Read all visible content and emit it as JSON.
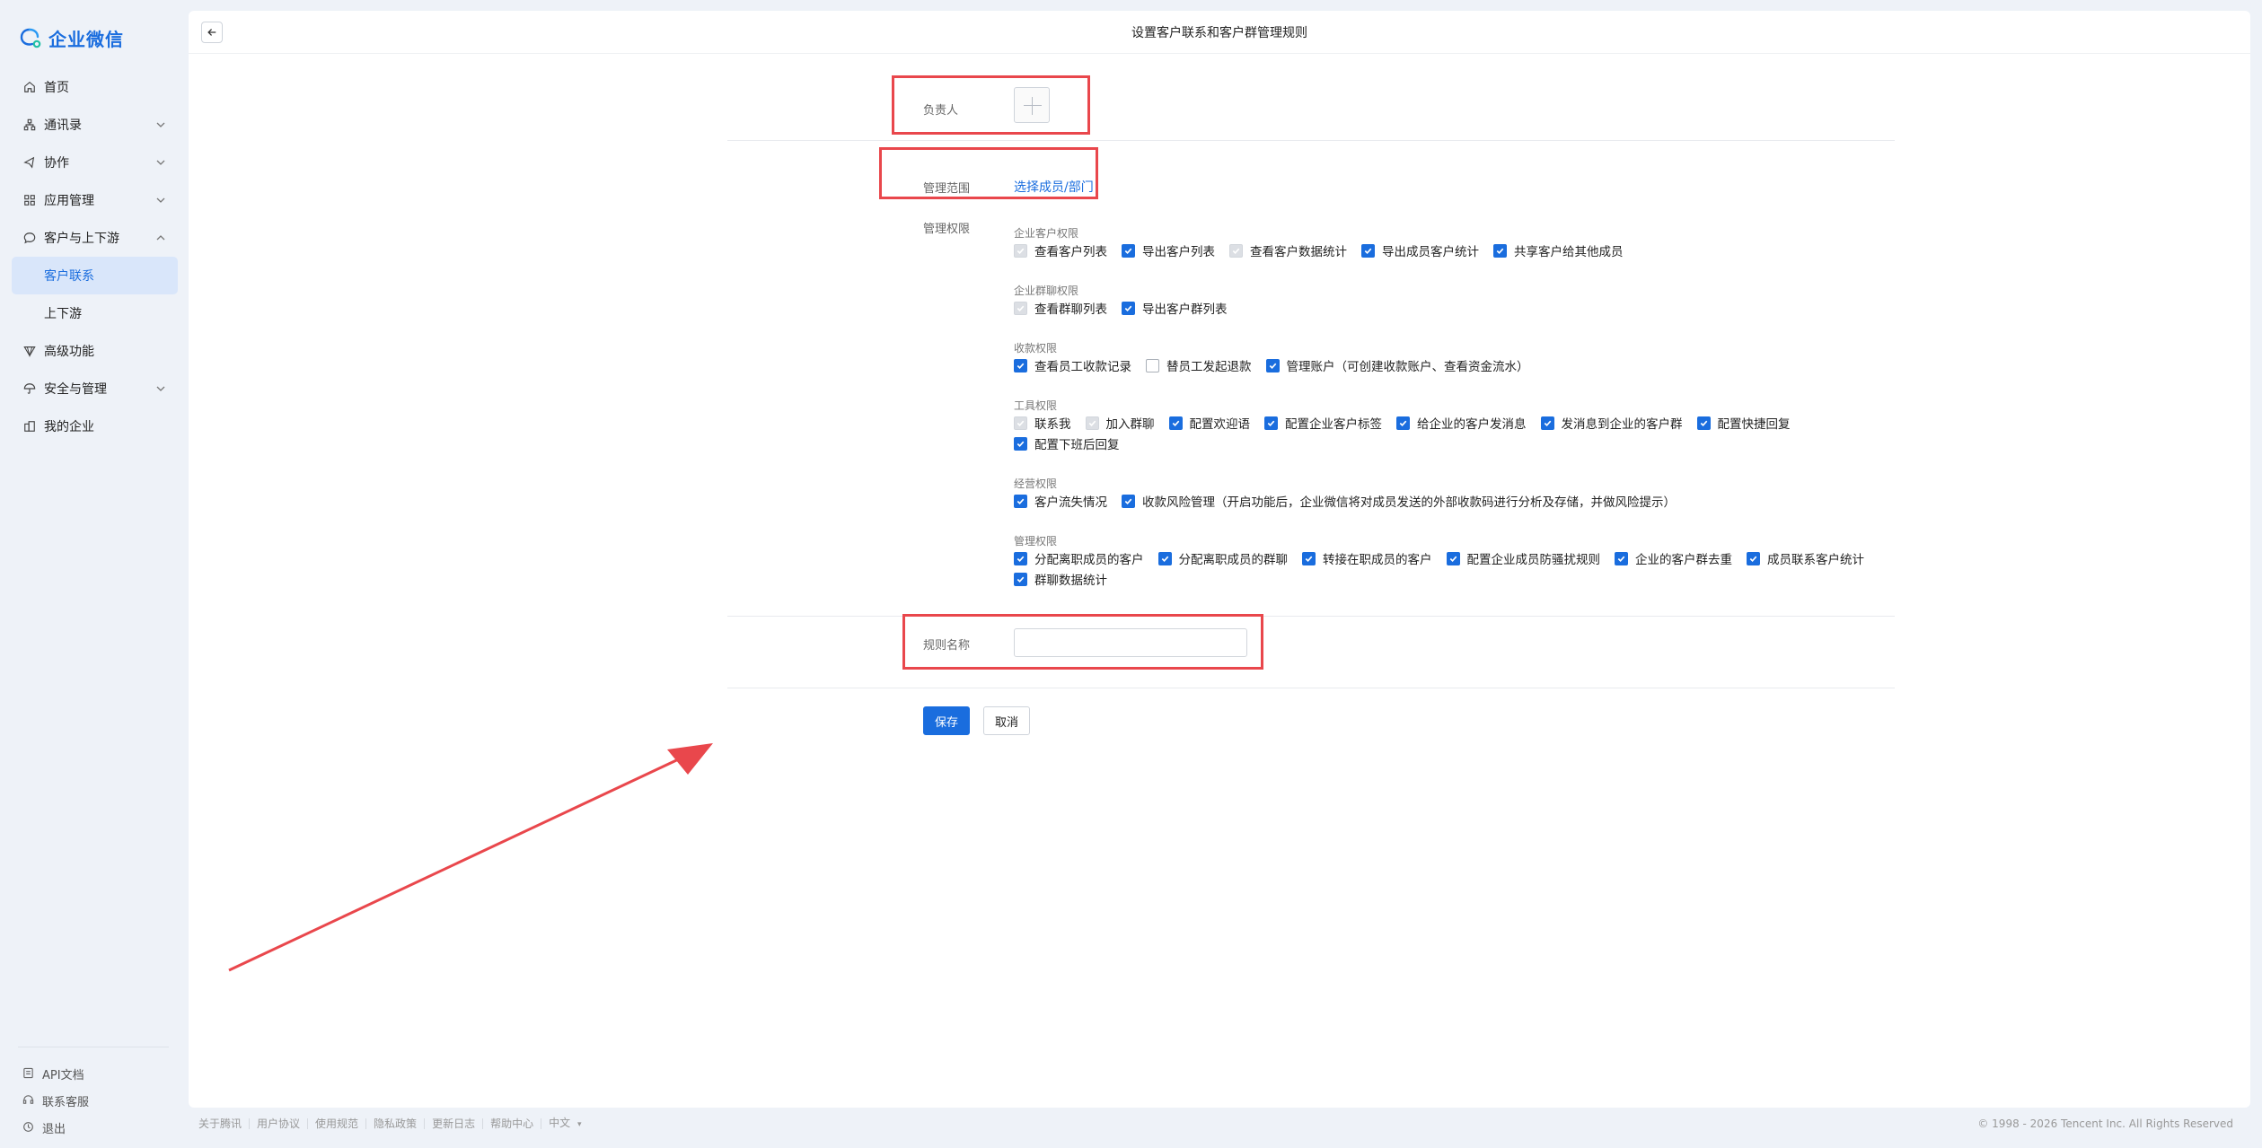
{
  "app": {
    "logo_text": "企业微信"
  },
  "sidebar": {
    "items": [
      {
        "label": "首页",
        "icon": "home-icon"
      },
      {
        "label": "通讯录",
        "icon": "org-icon"
      },
      {
        "label": "协作",
        "icon": "collab-icon"
      },
      {
        "label": "应用管理",
        "icon": "apps-icon"
      },
      {
        "label": "客户与上下游",
        "icon": "chat-icon"
      },
      {
        "label": "客户联系"
      },
      {
        "label": "上下游"
      },
      {
        "label": "高级功能",
        "icon": "advanced-icon"
      },
      {
        "label": "安全与管理",
        "icon": "umbrella-icon"
      },
      {
        "label": "我的企业",
        "icon": "building-icon"
      }
    ],
    "bottom": [
      {
        "label": "API文档"
      },
      {
        "label": "联系客服"
      },
      {
        "label": "退出"
      }
    ]
  },
  "page": {
    "title": "设置客户联系和客户群管理规则"
  },
  "form": {
    "owner_label": "负责人",
    "scope_label": "管理范围",
    "scope_link": "选择成员/部门",
    "perm_label": "管理权限",
    "groups": [
      {
        "title": "企业客户权限",
        "lines": [
          [
            {
              "label": "查看客户列表",
              "state": "disabled"
            },
            {
              "label": "导出客户列表",
              "state": "checked"
            },
            {
              "label": "查看客户数据统计",
              "state": "disabled"
            },
            {
              "label": "导出成员客户统计",
              "state": "checked"
            },
            {
              "label": "共享客户给其他成员",
              "state": "checked"
            }
          ]
        ]
      },
      {
        "title": "企业群聊权限",
        "lines": [
          [
            {
              "label": "查看群聊列表",
              "state": "disabled"
            },
            {
              "label": "导出客户群列表",
              "state": "checked"
            }
          ]
        ]
      },
      {
        "title": "收款权限",
        "lines": [
          [
            {
              "label": "查看员工收款记录",
              "state": "checked"
            },
            {
              "label": "替员工发起退款",
              "state": "unchecked"
            },
            {
              "label": "管理账户（可创建收款账户、查看资金流水）",
              "state": "checked"
            }
          ]
        ]
      },
      {
        "title": "工具权限",
        "lines": [
          [
            {
              "label": "联系我",
              "state": "disabled"
            },
            {
              "label": "加入群聊",
              "state": "disabled"
            },
            {
              "label": "配置欢迎语",
              "state": "checked"
            },
            {
              "label": "配置企业客户标签",
              "state": "checked"
            },
            {
              "label": "给企业的客户发消息",
              "state": "checked"
            },
            {
              "label": "发消息到企业的客户群",
              "state": "checked"
            },
            {
              "label": "配置快捷回复",
              "state": "checked"
            }
          ],
          [
            {
              "label": "配置下班后回复",
              "state": "checked"
            }
          ]
        ]
      },
      {
        "title": "经营权限",
        "lines": [
          [
            {
              "label": "客户流失情况",
              "state": "checked"
            },
            {
              "label": "收款风险管理（开启功能后，企业微信将对成员发送的外部收款码进行分析及存储，并做风险提示）",
              "state": "checked"
            }
          ]
        ]
      },
      {
        "title": "管理权限",
        "lines": [
          [
            {
              "label": "分配离职成员的客户",
              "state": "checked"
            },
            {
              "label": "分配离职成员的群聊",
              "state": "checked"
            },
            {
              "label": "转接在职成员的客户",
              "state": "checked"
            },
            {
              "label": "配置企业成员防骚扰规则",
              "state": "checked"
            },
            {
              "label": "企业的客户群去重",
              "state": "checked"
            },
            {
              "label": "成员联系客户统计",
              "state": "checked"
            }
          ],
          [
            {
              "label": "群聊数据统计",
              "state": "checked"
            }
          ]
        ]
      }
    ],
    "rule_name_label": "规则名称",
    "rule_name_value": "",
    "save_label": "保存",
    "cancel_label": "取消"
  },
  "footer": {
    "links": [
      "关于腾讯",
      "用户协议",
      "使用规范",
      "隐私政策",
      "更新日志",
      "帮助中心",
      "中文"
    ],
    "copyright": "© 1998 - 2026 Tencent Inc. All Rights Reserved"
  },
  "colors": {
    "accent": "#1a6dde",
    "highlight": "#e9474c"
  }
}
